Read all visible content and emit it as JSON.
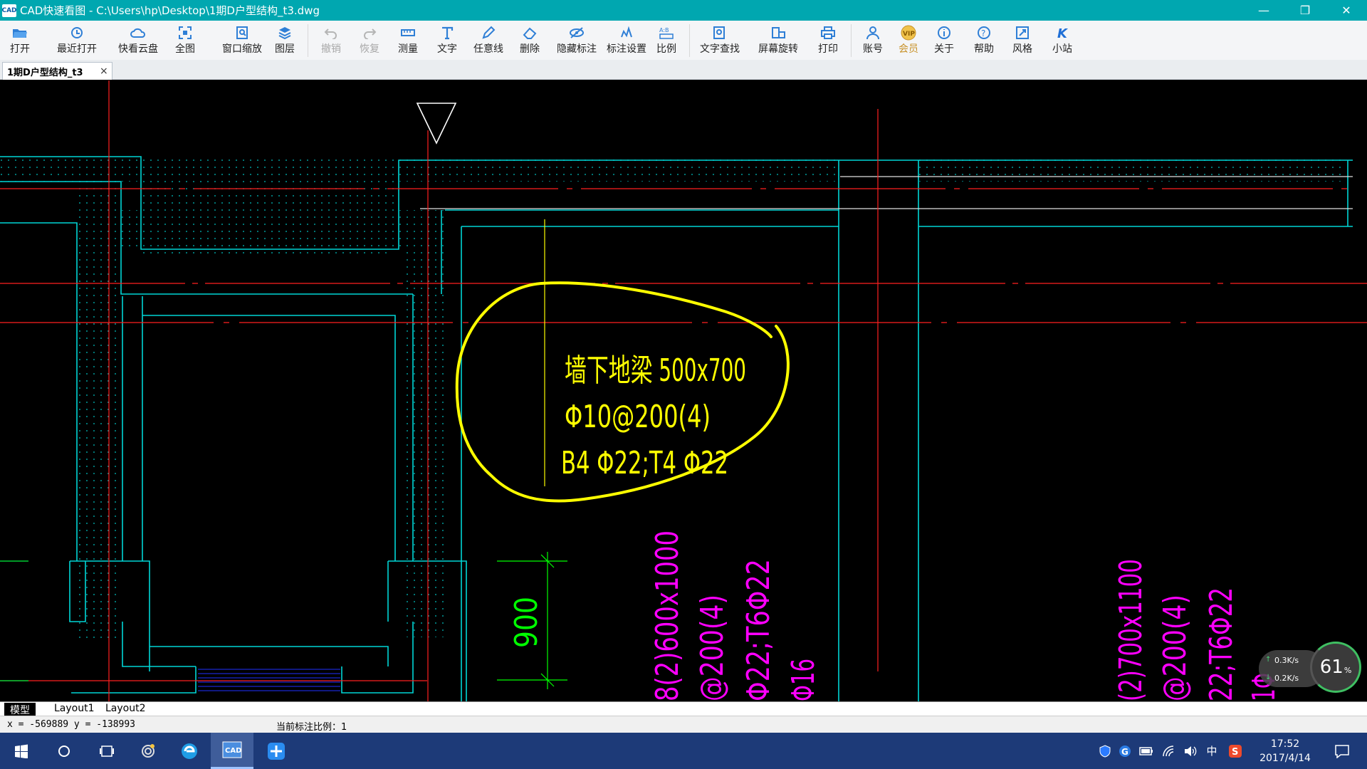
{
  "window": {
    "title": "CAD快速看图 - C:\\Users\\hp\\Desktop\\1期D户型结构_t3.dwg",
    "app_icon_text": "CAD"
  },
  "toolbar": {
    "items": [
      {
        "label": "打开",
        "icon": "folder-open-icon"
      },
      {
        "label": "最近打开",
        "icon": "clock-history-icon"
      },
      {
        "label": "快看云盘",
        "icon": "cloud-icon"
      },
      {
        "label": "全图",
        "icon": "fit-all-icon"
      },
      {
        "label": "窗口缩放",
        "icon": "zoom-window-icon"
      },
      {
        "label": "图层",
        "icon": "layers-icon"
      },
      {
        "label": "撤销",
        "icon": "undo-icon"
      },
      {
        "label": "恢复",
        "icon": "redo-icon"
      },
      {
        "label": "测量",
        "icon": "measure-icon"
      },
      {
        "label": "文字",
        "icon": "text-icon"
      },
      {
        "label": "任意线",
        "icon": "pen-icon"
      },
      {
        "label": "删除",
        "icon": "eraser-icon"
      },
      {
        "label": "隐藏标注",
        "icon": "eye-hide-icon"
      },
      {
        "label": "标注设置",
        "icon": "annotation-settings-icon"
      },
      {
        "label": "比例",
        "icon": "scale-icon"
      },
      {
        "label": "文字查找",
        "icon": "text-search-icon"
      },
      {
        "label": "屏幕旋转",
        "icon": "rotate-screen-icon"
      },
      {
        "label": "打印",
        "icon": "printer-icon"
      },
      {
        "label": "账号",
        "icon": "user-icon"
      },
      {
        "label": "会员",
        "icon": "vip-icon"
      },
      {
        "label": "关于",
        "icon": "info-icon"
      },
      {
        "label": "帮助",
        "icon": "help-icon"
      },
      {
        "label": "风格",
        "icon": "style-icon"
      },
      {
        "label": "小站",
        "icon": "site-icon"
      }
    ]
  },
  "tabs": {
    "document": "1期D户型结构_t3",
    "close": "×"
  },
  "drawing": {
    "annotation_line1": "墙下地梁 500x700",
    "annotation_line2": "Φ10@200(4)",
    "annotation_line3": "B4 Φ22;T4 Φ22",
    "dimension": "900",
    "magenta_left": [
      "8(2)600x1000",
      "@200(4)",
      "Φ22;T6Φ22",
      "Φ16"
    ],
    "magenta_right": [
      "(2)700x1100",
      "@200(4)",
      "22;T6Φ22",
      "1Φ"
    ],
    "colors": {
      "cyan": "#00d6d6",
      "red": "#ff2020",
      "yellow": "#ffff00",
      "magenta": "#ff00ff",
      "green": "#00ff00",
      "white": "#ffffff"
    }
  },
  "net_widget": {
    "up": "0.3K/s",
    "down": "0.2K/s",
    "percent": "61",
    "percent_unit": "%"
  },
  "layout_tabs": [
    "模型",
    "Layout1",
    "Layout2"
  ],
  "status": {
    "coords": "x = -569889 y = -138993",
    "scale_label": "当前标注比例：1"
  },
  "taskbar": {
    "time": "17:52",
    "date": "2017/4/14",
    "ime": "中"
  }
}
